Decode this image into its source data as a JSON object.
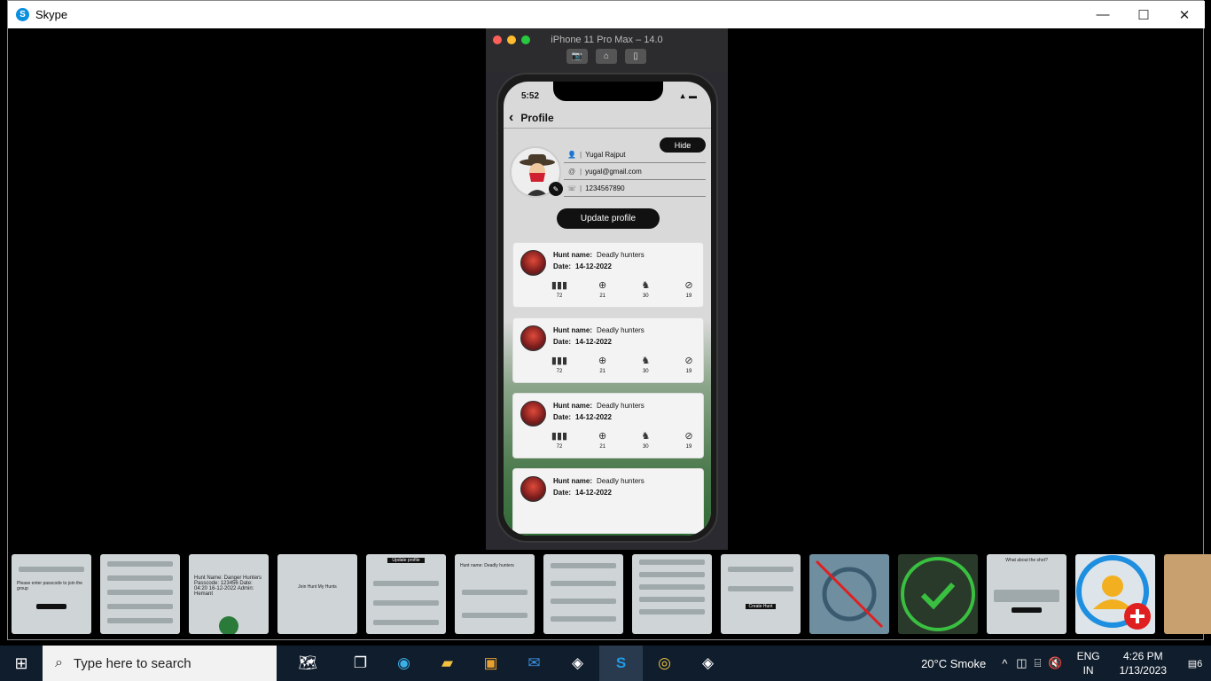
{
  "window": {
    "title": "Skype",
    "minimize": "—",
    "maximize": "☐",
    "close": "✕"
  },
  "simulator": {
    "title": "iPhone 11 Pro Max – 14.0",
    "tools": [
      "📷",
      "⌂",
      "▯"
    ]
  },
  "phone": {
    "time": "5:52",
    "status_icons": "▲ ▬",
    "nav": {
      "back": "‹",
      "title": "Profile"
    },
    "hide_label": "Hide",
    "fields": [
      {
        "icon": "👤",
        "value": "Yugal Rajput"
      },
      {
        "icon": "@",
        "value": "yugal@gmail.com"
      },
      {
        "icon": "☏",
        "value": "1234567890"
      }
    ],
    "update_label": "Update profile",
    "hunts": [
      {
        "name_label": "Hunt name:",
        "name": "Deadly hunters",
        "date_label": "Date:",
        "date": "14-12-2022",
        "stats": [
          "72",
          "21",
          "30",
          "19"
        ]
      },
      {
        "name_label": "Hunt name:",
        "name": "Deadly hunters",
        "date_label": "Date:",
        "date": "14-12-2022",
        "stats": [
          "72",
          "21",
          "30",
          "19"
        ]
      },
      {
        "name_label": "Hunt name:",
        "name": "Deadly hunters",
        "date_label": "Date:",
        "date": "14-12-2022",
        "stats": [
          "72",
          "21",
          "30",
          "19"
        ]
      },
      {
        "name_label": "Hunt name:",
        "name": "Deadly hunters",
        "date_label": "Date:",
        "date": "14-12-2022",
        "stats": [
          "",
          "",
          "",
          ""
        ]
      }
    ],
    "stat_icons": [
      "▮▮▮",
      "⊕",
      "♞",
      "⊘"
    ]
  },
  "thumbnails": [
    "Please enter passcode to join the group",
    "",
    "Hunt Name: Danger Hunters Passcode: 123456 Date: 04:20 16-12-2022 Admin: Hemant",
    "Join Hunt My Hunts",
    "Update profile",
    "Hunt name: Deadly hunters",
    "",
    "",
    "Create Hunt",
    "",
    "",
    "What about the shot?",
    "",
    ""
  ],
  "taskbar": {
    "search_placeholder": "Type here to search",
    "weather": "20°C  Smoke",
    "lang_top": "ENG",
    "lang_bottom": "IN",
    "time": "4:26 PM",
    "date": "1/13/2023",
    "notifications": "6"
  }
}
